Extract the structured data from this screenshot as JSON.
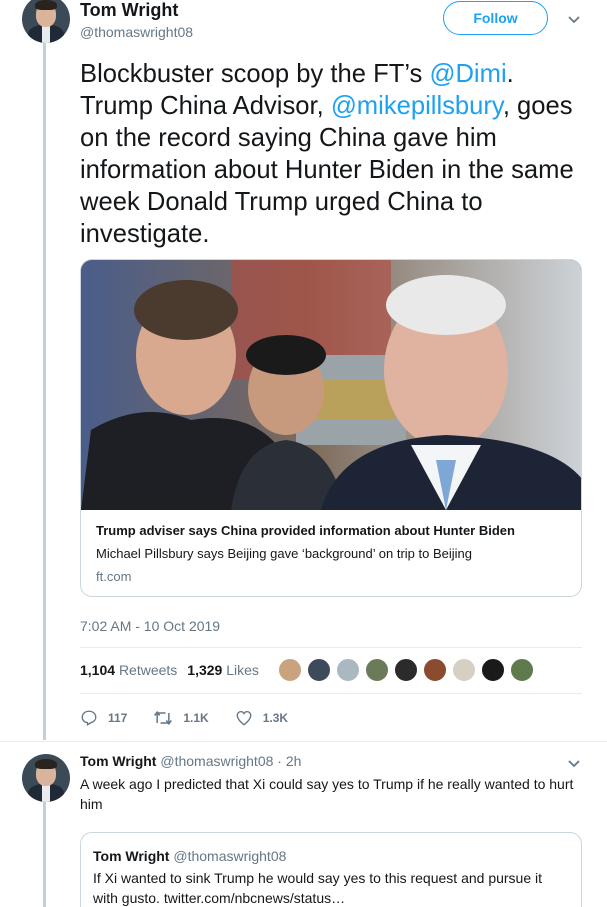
{
  "author": {
    "name": "Tom Wright",
    "handle": "@thomaswright08"
  },
  "follow_label": "Follow",
  "tweet": {
    "text_1": "Blockbuster scoop by the FT’s ",
    "mention_1": "@Dimi",
    "text_2": ". Trump China Advisor, ",
    "mention_2": "@mikepillsbury",
    "text_3": ", goes on the record saying China gave him information about Hunter Biden in the same week Donald Trump urged China to investigate."
  },
  "card": {
    "title": "Trump adviser says China provided information about Hunter Biden",
    "description": "Michael Pillsbury says Beijing gave ‘background’ on trip to Beijing",
    "domain": "ft.com"
  },
  "timestamp": "7:02 AM - 10 Oct 2019",
  "stats": {
    "retweets_count": "1,104",
    "retweets_label": "Retweets",
    "likes_count": "1,329",
    "likes_label": "Likes"
  },
  "likers": [
    "#c9a27e",
    "#3d4a5a",
    "#aab8c2",
    "#6b7b5a",
    "#2b2b2b",
    "#8a4b2f",
    "#d6d0c4",
    "#1a1a1a",
    "#5f7a4d"
  ],
  "actions": {
    "replies": "117",
    "retweets": "1.1K",
    "likes": "1.3K"
  },
  "reply": {
    "name": "Tom Wright",
    "handle": "@thomaswright08",
    "time": "· 2h",
    "text": "A week ago I predicted that Xi could say yes to Trump if he really wanted to hurt him"
  },
  "quote": {
    "name": "Tom Wright",
    "handle": "@thomaswright08",
    "text": "If Xi wanted to sink Trump he would say yes to this request and pursue it with gusto. twitter.com/nbcnews/status…"
  },
  "colors": {
    "accent": "#1da1f2",
    "muted": "#657786",
    "border": "#ccd6dd"
  }
}
